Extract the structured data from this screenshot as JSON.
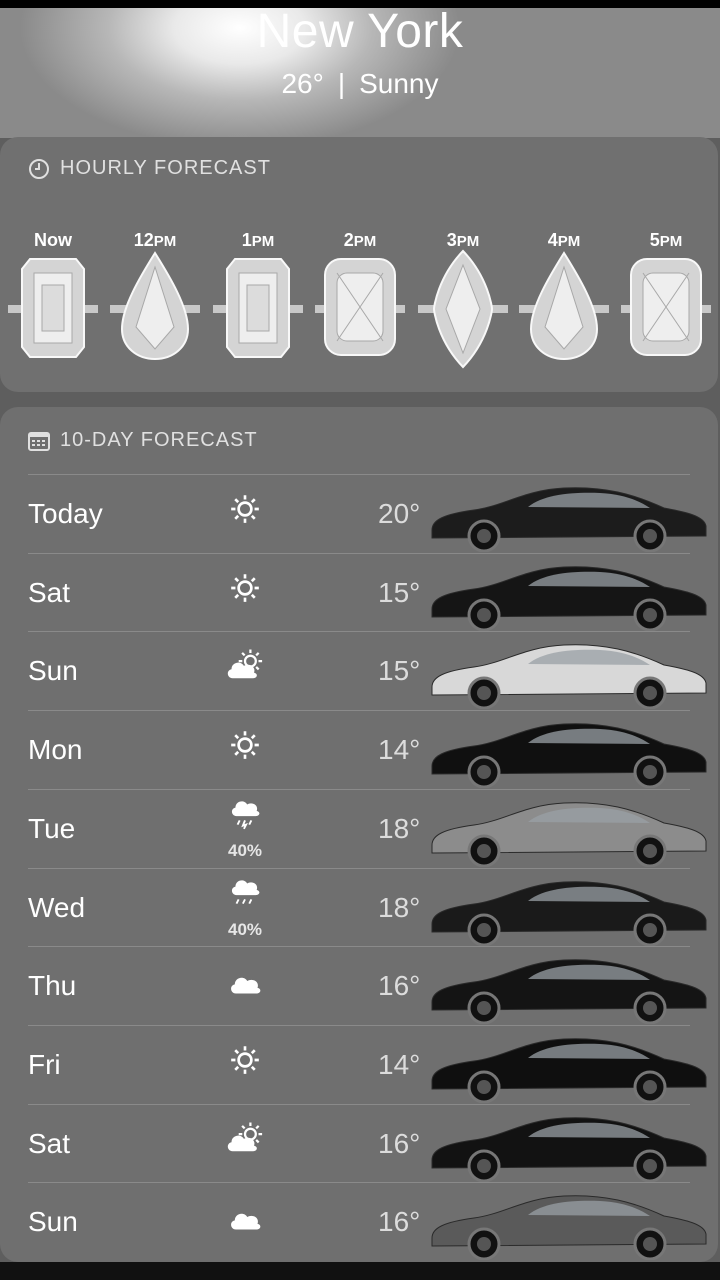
{
  "header": {
    "city": "New York",
    "temperature": "26°",
    "separator": "|",
    "condition": "Sunny"
  },
  "hourly": {
    "title": "HOURLY FORECAST",
    "icon": "clock-icon",
    "hours": [
      {
        "label_main": "Now",
        "label_suffix": ""
      },
      {
        "label_main": "12",
        "label_suffix": "PM"
      },
      {
        "label_main": "1",
        "label_suffix": "PM"
      },
      {
        "label_main": "2",
        "label_suffix": "PM"
      },
      {
        "label_main": "3",
        "label_suffix": "PM"
      },
      {
        "label_main": "4",
        "label_suffix": "PM"
      },
      {
        "label_main": "5",
        "label_suffix": "PM"
      }
    ],
    "stone_shapes": [
      "emerald",
      "pear",
      "emerald",
      "cushion",
      "marquise",
      "pear",
      "cushion"
    ]
  },
  "daily": {
    "title": "10-DAY FORECAST",
    "icon": "calendar-icon",
    "days": [
      {
        "day": "Today",
        "icon": "sun-icon",
        "precip": "",
        "temp": "20°",
        "car_color": "#1c1c1c"
      },
      {
        "day": "Sat",
        "icon": "sun-icon",
        "precip": "",
        "temp": "15°",
        "car_color": "#151515"
      },
      {
        "day": "Sun",
        "icon": "partly-cloudy-icon",
        "precip": "",
        "temp": "15°",
        "car_color": "#d8d8d8"
      },
      {
        "day": "Mon",
        "icon": "sun-icon",
        "precip": "",
        "temp": "14°",
        "car_color": "#101010"
      },
      {
        "day": "Tue",
        "icon": "thunderstorm-icon",
        "precip": "40%",
        "temp": "18°",
        "car_color": "#8c8c8c"
      },
      {
        "day": "Wed",
        "icon": "rain-cloud-icon",
        "precip": "40%",
        "temp": "18°",
        "car_color": "#1a1a1a"
      },
      {
        "day": "Thu",
        "icon": "cloud-icon",
        "precip": "",
        "temp": "16°",
        "car_color": "#141414"
      },
      {
        "day": "Fri",
        "icon": "sun-icon",
        "precip": "",
        "temp": "14°",
        "car_color": "#0f0f0f"
      },
      {
        "day": "Sat",
        "icon": "partly-cloudy-icon",
        "precip": "",
        "temp": "16°",
        "car_color": "#121212"
      },
      {
        "day": "Sun",
        "icon": "cloud-icon",
        "precip": "",
        "temp": "16°",
        "car_color": "#5a5a5a"
      }
    ]
  },
  "colors": {
    "background": "#5e5e5e",
    "card": "#707070",
    "text": "#ffffff"
  }
}
